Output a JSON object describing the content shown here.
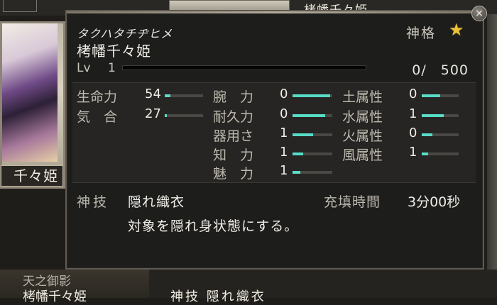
{
  "background": {
    "top_title": "栲幡千々姫",
    "bottom_title": "天之御影",
    "bottom_name": "栲幡千々姫",
    "bottom_skill": "神技 隠れ織衣"
  },
  "card": {
    "name_label": "千々姫"
  },
  "popup": {
    "close_icon": "×",
    "kana": "タクハタチヂヒメ",
    "name": "栲幡千々姫",
    "rank_label": "神格",
    "rank_icon": "★",
    "level_label": "Lv",
    "level": "1",
    "exp_current": "0",
    "exp_max": "500",
    "exp_text": "0/　500",
    "exp_fraction": 0.0,
    "stats": [
      {
        "label": "生命力",
        "value": "54",
        "fraction": 0.14
      },
      {
        "label": "気　合",
        "value": "27",
        "fraction": 0.06
      },
      {
        "label": "腕　力",
        "value": "0",
        "fraction": 0.95
      },
      {
        "label": "耐久力",
        "value": "0",
        "fraction": 0.82
      },
      {
        "label": "器用さ",
        "value": "1",
        "fraction": 0.52
      },
      {
        "label": "知　力",
        "value": "1",
        "fraction": 0.26
      },
      {
        "label": "魅　力",
        "value": "1",
        "fraction": 0.2
      },
      {
        "label": "土属性",
        "value": "0",
        "fraction": 0.5
      },
      {
        "label": "水属性",
        "value": "1",
        "fraction": 0.6
      },
      {
        "label": "火属性",
        "value": "0",
        "fraction": 0.28
      },
      {
        "label": "風属性",
        "value": "1",
        "fraction": 0.18
      }
    ],
    "skill_label": "神技",
    "skill_name": "隠れ織衣",
    "charge_label": "充填時間",
    "charge_value": "3分00秒",
    "skill_desc": "対象を隠れ身状態にする。"
  },
  "colors": {
    "accent": "#58dcc6",
    "star": "#e9c43a"
  }
}
